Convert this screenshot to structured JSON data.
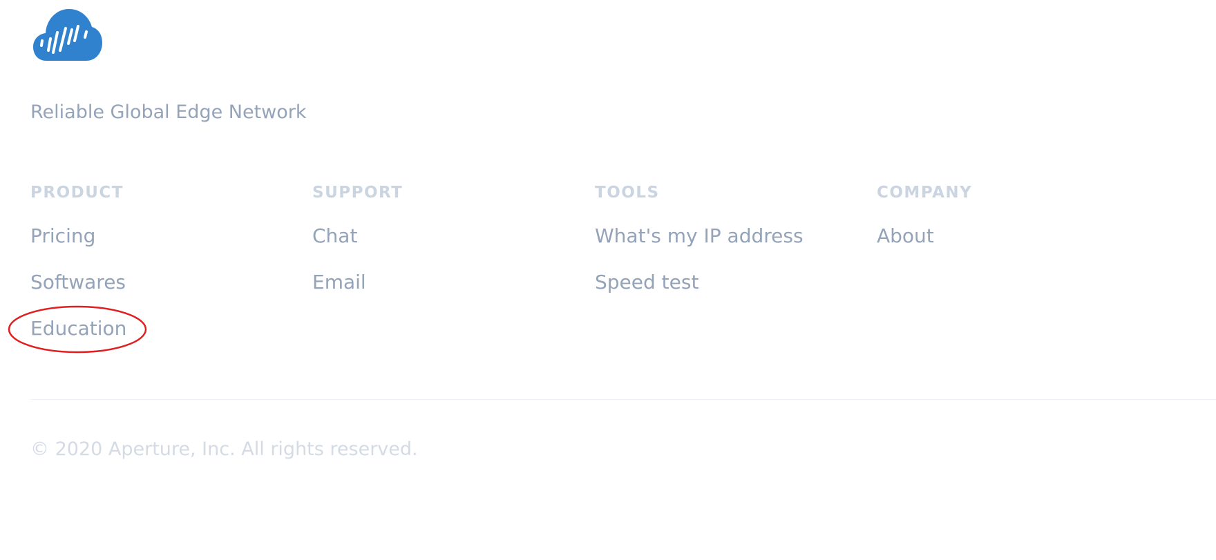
{
  "brand": {
    "logo_icon": "cloud-soundwave-icon",
    "logo_color": "#3182ce",
    "tagline": "Reliable Global Edge Network"
  },
  "columns": [
    {
      "heading": "PRODUCT",
      "links": [
        "Pricing",
        "Softwares",
        "Education"
      ]
    },
    {
      "heading": "SUPPORT",
      "links": [
        "Chat",
        "Email"
      ]
    },
    {
      "heading": "TOOLS",
      "links": [
        "What's my IP address",
        "Speed test"
      ]
    },
    {
      "heading": "COMPANY",
      "links": [
        "About"
      ]
    }
  ],
  "copyright": "© 2020 Aperture, Inc. All rights reserved.",
  "annotation": {
    "highlight_color": "#e02020",
    "highlighted_link": "Education"
  },
  "colors": {
    "link": "#94a3b8",
    "heading": "#cbd5e1",
    "copyright": "#d4dbe4"
  }
}
